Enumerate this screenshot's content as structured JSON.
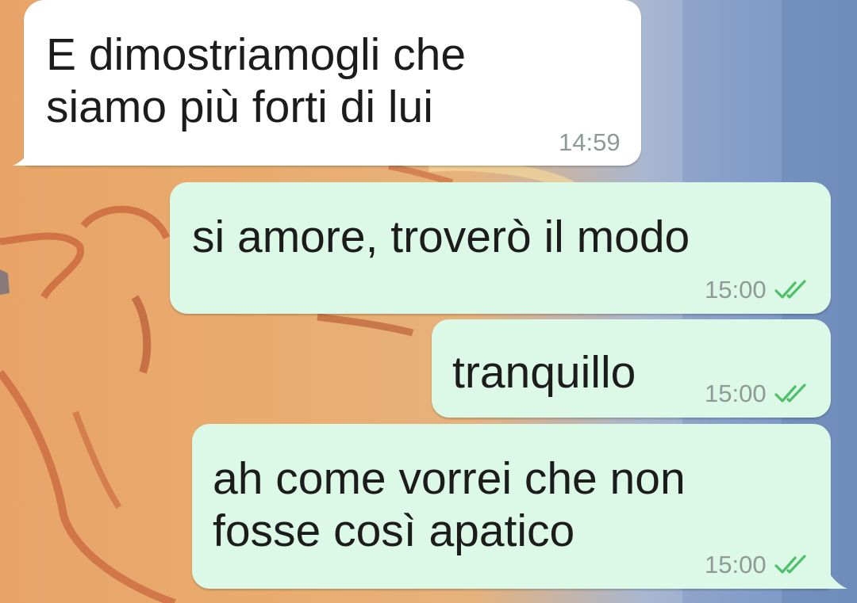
{
  "chat": {
    "messages": [
      {
        "direction": "incoming",
        "text": "E dimostriamogli che\nsiamo più forti di lui",
        "time": "14:59"
      },
      {
        "direction": "outgoing",
        "text": "si amore, troverò il modo",
        "time": "15:00",
        "status_icon": "double-check-icon"
      },
      {
        "direction": "outgoing",
        "text": "tranquillo",
        "time": "15:00",
        "status_icon": "double-check-icon"
      },
      {
        "direction": "outgoing",
        "text": "ah come vorrei che non\nfosse così apatico",
        "time": "15:00",
        "status_icon": "double-check-icon"
      }
    ]
  },
  "colors": {
    "incoming_bubble": "#ffffff",
    "outgoing_bubble": "#dcf8e6",
    "read_check": "#4fc06a",
    "time_text": "#8f9a97"
  }
}
